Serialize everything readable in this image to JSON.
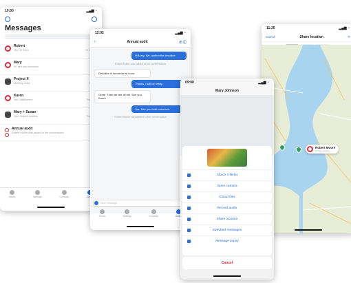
{
  "phone1": {
    "time": "10:00",
    "title": "Messages",
    "conversations": [
      {
        "name": "Robert",
        "preview": "You: Hi there",
        "time": "15 minutes"
      },
      {
        "name": "Mary",
        "preview": "Hi, see you tomorrow",
        "time": "1 hour"
      },
      {
        "name": "Project X",
        "preview": "Meeting notes",
        "time": "2 hours"
      },
      {
        "name": "Karen",
        "preview": "You: Attachment",
        "time": "Yesterday"
      },
      {
        "name": "Mary + Susan",
        "preview": "You: Shared location",
        "time": "Yesterday"
      },
      {
        "name": "Annual audit",
        "preview": "Robert Moore was added to the conversation",
        "time": ""
      }
    ],
    "tabs": [
      "Home",
      "Settings",
      "Contacts",
      "Chats"
    ]
  },
  "phone2": {
    "time": "12:02",
    "title": "Annual audit",
    "messages": [
      {
        "dir": "out",
        "text": "Hi Mary, We confirm the deadline"
      },
      {
        "dir": "sys",
        "text": "Robert Miller was added to the conversation"
      },
      {
        "dir": "in",
        "text": "Deadline is tomorrow at noon."
      },
      {
        "dir": "out",
        "text": "Thanks, I will be ready."
      },
      {
        "dir": "in",
        "text": "Great. Then we are all set. See you. Karen"
      },
      {
        "dir": "out",
        "text": "Yes. See you both tomorrow."
      },
      {
        "dir": "sys",
        "text": "Robert Moore was added to the conversation"
      }
    ],
    "compose_placeholder": "New message",
    "tabs": [
      "Home",
      "Settings",
      "Contacts",
      "Chats"
    ]
  },
  "phone3": {
    "time": "09:08",
    "title": "Mary Johnson",
    "sheet_items": [
      "Attach 1 file(s)",
      "Open camera",
      "iCloud files",
      "Record audio",
      "Share location",
      "Standard messages",
      "Message expiry"
    ],
    "cancel_label": "Cancel"
  },
  "phone4": {
    "time": "11:20",
    "cancel_label": "Cancel",
    "title": "Share location",
    "segments": [
      "Map",
      "Hybrid",
      "Satellite"
    ],
    "pin_name": "Robert Moore",
    "pin_sub": "Current location"
  },
  "colors": {
    "accent": "#2a6fdb",
    "avatar_ring": "#d42a3a",
    "map_water": "#a8d4f0",
    "map_land": "#e8edd8"
  }
}
